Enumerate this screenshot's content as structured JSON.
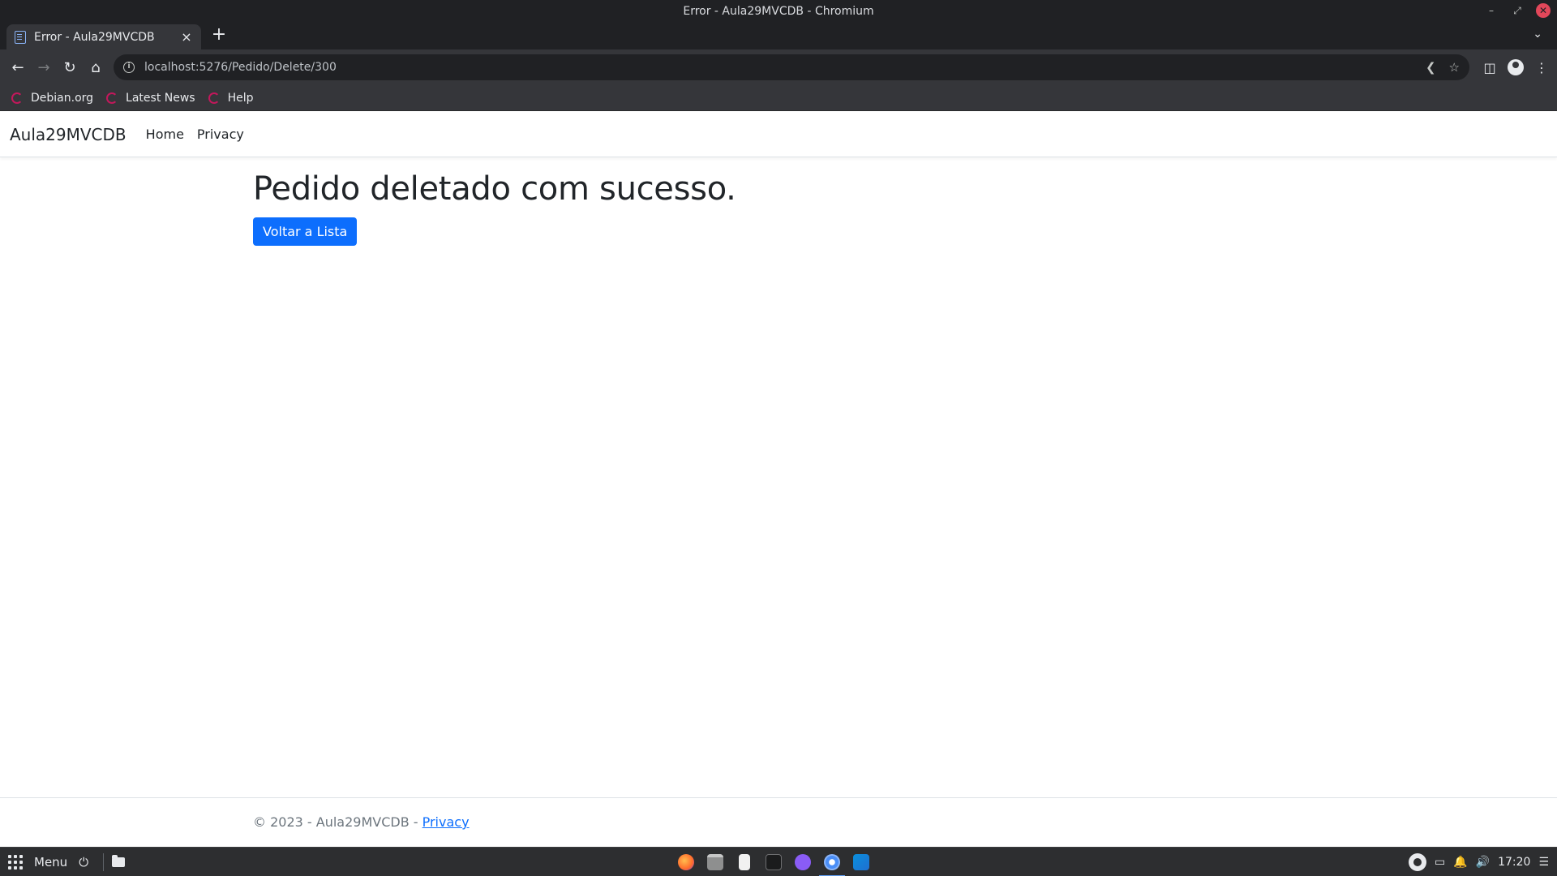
{
  "window": {
    "title": "Error - Aula29MVCDB - Chromium"
  },
  "tabs": [
    {
      "title": "Error - Aula29MVCDB"
    }
  ],
  "toolbar": {
    "url": "localhost:5276/Pedido/Delete/300"
  },
  "bookmarks": [
    {
      "label": "Debian.org"
    },
    {
      "label": "Latest News"
    },
    {
      "label": "Help"
    }
  ],
  "site": {
    "brand": "Aula29MVCDB",
    "nav": [
      {
        "label": "Home"
      },
      {
        "label": "Privacy"
      }
    ],
    "heading": "Pedido deletado com sucesso.",
    "back_button": "Voltar a Lista",
    "footer_text": "© 2023 - Aula29MVCDB - ",
    "footer_link": "Privacy"
  },
  "taskbar": {
    "menu_label": "Menu",
    "apps": [
      "firefox-icon",
      "files-icon",
      "text-editor-icon",
      "terminal-icon",
      "github-desktop-icon",
      "chromium-icon",
      "vscode-icon"
    ],
    "clock": "17:20"
  },
  "colors": {
    "primary_button": "#0d6efd",
    "link": "#0d6efd",
    "browser_chrome": "#35363a"
  }
}
